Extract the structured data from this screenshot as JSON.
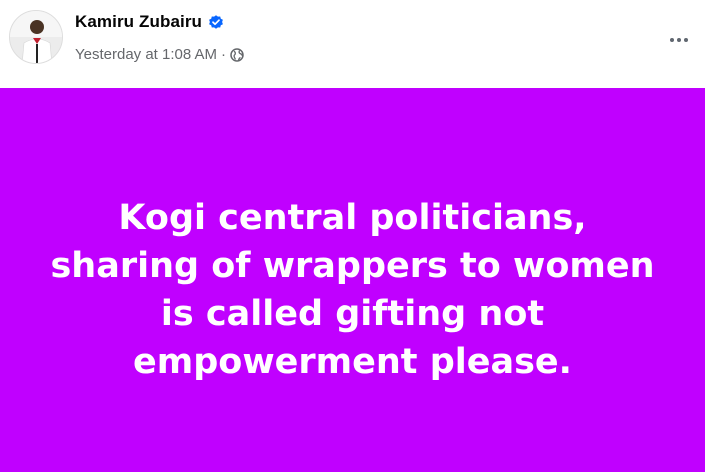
{
  "post": {
    "author": "Kamiru Zubairu",
    "timestamp": "Yesterday at 1:08 AM",
    "separator": "·",
    "audience_icon": "globe-icon",
    "verified_icon": "verified-badge-icon",
    "more_icon": "more-options-icon",
    "background_color": "#c000ff",
    "text_color": "#ffffff",
    "verified_color": "#0866ff",
    "text_lines": [
      "Kogi central politicians,",
      "sharing of wrappers to women",
      "is called gifting not",
      "empowerment please."
    ]
  }
}
